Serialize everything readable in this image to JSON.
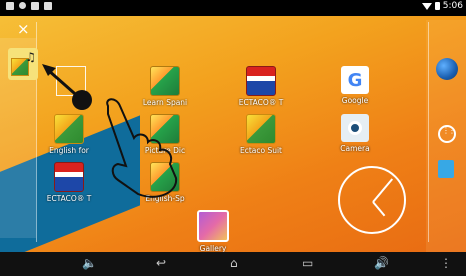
{
  "status": {
    "time": "5:06"
  },
  "close_label": "×",
  "apps": [
    {
      "label": "Learn Spani",
      "kind": "book"
    },
    {
      "label": "ECTACO® T",
      "kind": "flag"
    },
    {
      "label": "Google",
      "kind": "google"
    },
    {
      "label": "English for",
      "kind": "book"
    },
    {
      "label": "Picture Dic",
      "kind": "book"
    },
    {
      "label": "Ectaco Suit",
      "kind": "book"
    },
    {
      "label": "Camera",
      "kind": "camera"
    },
    {
      "label": "ECTACO® T",
      "kind": "flag"
    },
    {
      "label": "English-Sp",
      "kind": "book"
    },
    {
      "label": "Gallery",
      "kind": "gallery"
    }
  ],
  "google_glyph": "G",
  "nav": {
    "vol_down": "🔈",
    "back": "↩",
    "home": "⌂",
    "recents": "▭",
    "vol_up": "🔊",
    "menu": "⋮"
  },
  "folder_note": "♫"
}
